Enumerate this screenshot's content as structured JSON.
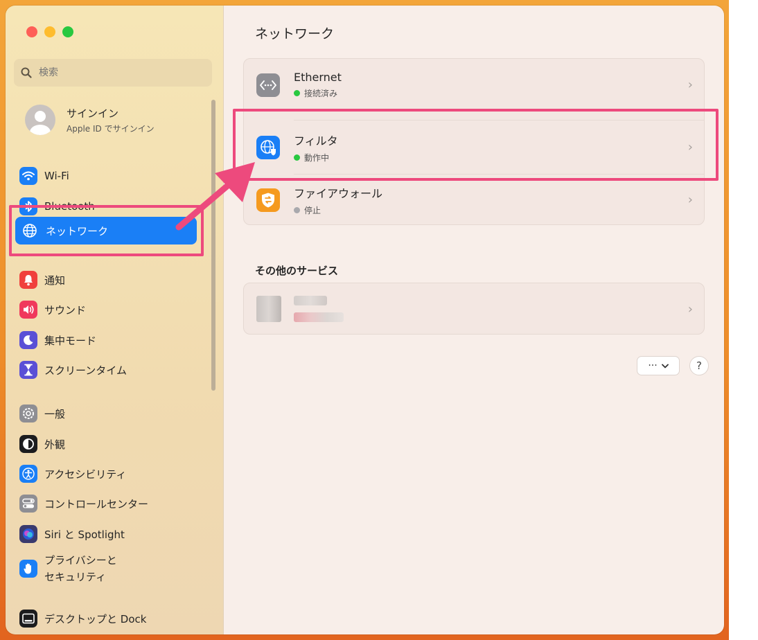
{
  "window": {
    "traffic_lights": [
      "#fe5f57",
      "#febc2e",
      "#28c840"
    ]
  },
  "sidebar": {
    "search": {
      "placeholder": "検索",
      "icon": "magnifier-icon"
    },
    "account": {
      "name": "サインイン",
      "subtitle": "Apple ID でサインイン",
      "icon": "person-icon"
    },
    "items": [
      {
        "id": "wifi",
        "label": "Wi-Fi",
        "icon": "wifi-icon",
        "color": "#1a7ff6"
      },
      {
        "id": "bluetooth",
        "label": "Bluetooth",
        "icon": "bluetooth-icon",
        "color": "#1a7ff6"
      },
      {
        "id": "network",
        "label": "ネットワーク",
        "icon": "globe-icon",
        "color": "#1a7ff6",
        "selected": true
      },
      {
        "id": "notifications",
        "label": "通知",
        "icon": "bell-icon",
        "color": "#f0403c"
      },
      {
        "id": "sound",
        "label": "サウンド",
        "icon": "speaker-icon",
        "color": "#f0385c"
      },
      {
        "id": "focus",
        "label": "集中モード",
        "icon": "moon-icon",
        "color": "#5a4fd6"
      },
      {
        "id": "screentime",
        "label": "スクリーンタイム",
        "icon": "hourglass-icon",
        "color": "#5a4fd6"
      },
      {
        "id": "general",
        "label": "一般",
        "icon": "gear-icon",
        "color": "#8e8e93"
      },
      {
        "id": "appearance",
        "label": "外観",
        "icon": "appearance-icon",
        "color": "#1c1c1e"
      },
      {
        "id": "accessibility",
        "label": "アクセシビリティ",
        "icon": "accessibility-icon",
        "color": "#1a7ff6"
      },
      {
        "id": "control-center",
        "label": "コントロールセンター",
        "icon": "switches-icon",
        "color": "#8e8e93"
      },
      {
        "id": "siri",
        "label": "Siri と Spotlight",
        "icon": "siri-icon",
        "color": "#3a3a6e"
      },
      {
        "id": "privacy",
        "label_line1": "プライバシーと",
        "label_line2": "セキュリティ",
        "icon": "hand-icon",
        "color": "#1a7ff6"
      },
      {
        "id": "desktop-dock",
        "label": "デスクトップと Dock",
        "icon": "dock-icon",
        "color": "#1c1c1e"
      }
    ]
  },
  "main": {
    "title": "ネットワーク",
    "services": [
      {
        "id": "ethernet",
        "label": "Ethernet",
        "status": "接続済み",
        "status_color": "#28c840",
        "icon": "ethernet-icon",
        "icon_bg": "#8e8e93"
      },
      {
        "id": "filter",
        "label": "フィルタ",
        "status": "動作中",
        "status_color": "#28c840",
        "icon": "filter-globe-icon",
        "icon_bg": "#1a7ff6"
      },
      {
        "id": "firewall",
        "label": "ファイアウォール",
        "status": "停止",
        "status_color": "#a9a9ad",
        "icon": "firewall-icon",
        "icon_bg": "#f59a1f"
      }
    ],
    "other_section": {
      "title": "その他のサービス"
    },
    "more_button": {
      "label": "···",
      "icon": "chevron-down-icon"
    },
    "help_button": {
      "label": "?"
    }
  },
  "annotation": {
    "highlight_color": "#ed4a7d"
  }
}
